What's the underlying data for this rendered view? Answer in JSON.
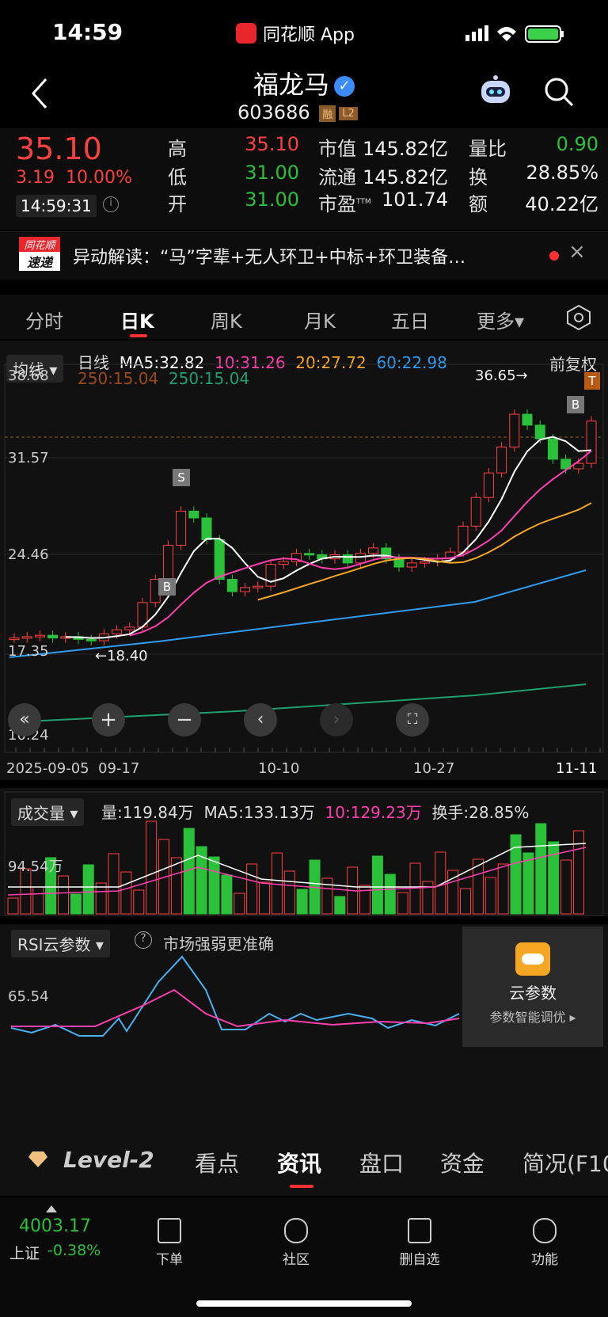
{
  "status_bar": {
    "time": "14:59",
    "app_name": "同花顺 App"
  },
  "header": {
    "title": "福龙马",
    "code": "603686",
    "tag1": "融",
    "tag2": "L2"
  },
  "quote": {
    "price": "35.10",
    "change": "3.19",
    "change_pct": "10.00%",
    "timestamp": "14:59:31",
    "high_label": "高",
    "high": "35.10",
    "low_label": "低",
    "low": "31.00",
    "open_label": "开",
    "open": "31.00",
    "mcap_label": "市值",
    "mcap": "145.82亿",
    "float_label": "流通",
    "float": "145.82亿",
    "pe_label": "市盈",
    "pe_sup": "TTM",
    "pe": "101.74",
    "vr_label": "量比",
    "vr": "0.90",
    "turn_label": "换",
    "turn": "28.85%",
    "amt_label": "额",
    "amt": "40.22亿"
  },
  "news": {
    "badge_top": "同花顺",
    "badge_bottom": "速递",
    "text": "异动解读：“马”字辈+无人环卫+中标+环卫装备…"
  },
  "tabs": [
    "分时",
    "日K",
    "周K",
    "月K",
    "五日",
    "更多▾"
  ],
  "ma_bar": {
    "dropdown": "均线",
    "line": "日线",
    "ma5": "MA5:32.82",
    "ma10": "10:31.26",
    "ma20": "20:27.72",
    "ma60": "60:22.98",
    "ma250a": "250:15.04",
    "ma250b": "250:15.04",
    "adjust": "前复权"
  },
  "kline": {
    "y_labels": [
      "38.68",
      "31.57",
      "24.46",
      "17.35",
      "10.24"
    ],
    "high_note": "36.65→",
    "low_note": "←18.40",
    "x_labels": [
      "2025-09-05",
      "09-17",
      "10-10",
      "10-27",
      "11-11"
    ],
    "markers": [
      "S",
      "B",
      "B",
      "T"
    ]
  },
  "volume": {
    "dropdown": "成交量",
    "vol": "量:119.84万",
    "ma5": "MA5:133.13万",
    "ma10": "10:129.23万",
    "turnover": "换手:28.85%",
    "y_label": "94.54万"
  },
  "rsi": {
    "dropdown": "RSI云参数",
    "hint": "市场强弱更准确",
    "y_label": "65.54",
    "card_title": "云参数",
    "card_sub": "参数智能调优 ▸"
  },
  "subtabs": [
    "Level-2",
    "看点",
    "资讯",
    "盘口",
    "资金",
    "简况(F10"
  ],
  "bottom": {
    "index_value": "4003.17",
    "index_name": "上证",
    "index_change": "-0.38%",
    "items": [
      "下单",
      "社区",
      "删自选",
      "功能"
    ]
  },
  "colors": {
    "up": "#ff4040",
    "down": "#2bc03a",
    "ma5": "#ffffff",
    "ma10": "#ff3fae",
    "ma20": "#f5a623",
    "ma60": "#2f9cf0",
    "ma250": "#1f9e6e"
  }
}
